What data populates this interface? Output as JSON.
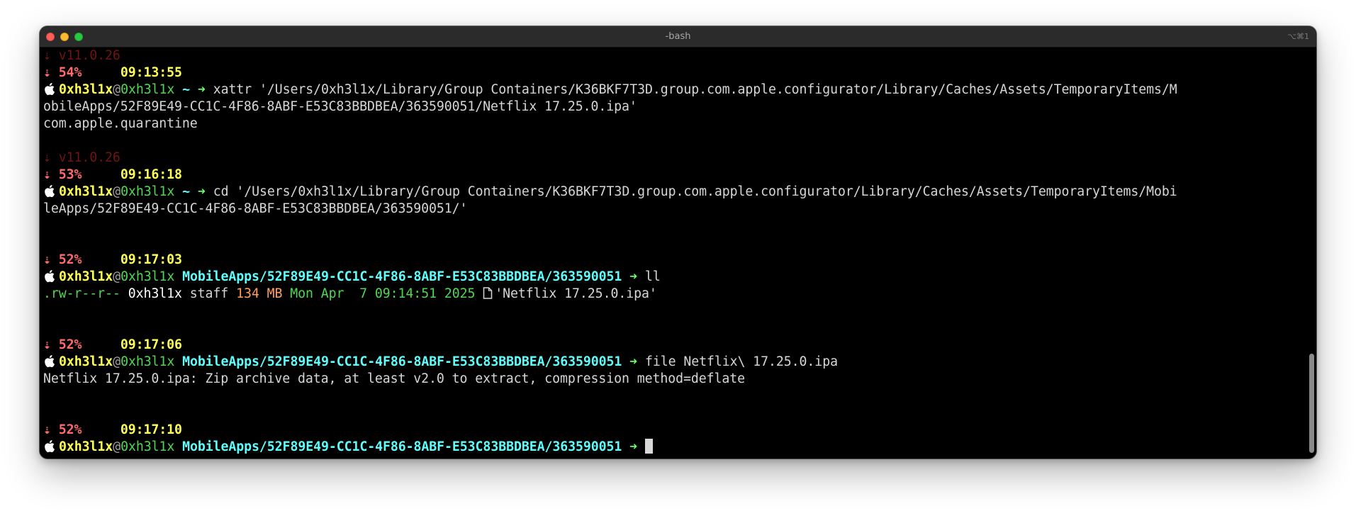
{
  "window": {
    "title": "-bash",
    "shortcut": "⌥⌘1"
  },
  "prompt": {
    "user": "0xh3l1x",
    "at": "@",
    "host": "0xh3l1x",
    "arrow": "➜",
    "home_dir": "~",
    "app_dir": "MobileApps/52F89E49-CC1C-4F86-8ABF-E53C83BBDBEA/363590051"
  },
  "blocks": [
    {
      "version": "⇣ v11.0.26",
      "battery": "⇣ 54%",
      "time": "09:13:55",
      "command_line_1": "xattr '/Users/0xh3l1x/Library/Group Containers/K36BKF7T3D.group.com.apple.configurator/Library/Caches/Assets/TemporaryItems/M",
      "command_line_2": "obileApps/52F89E49-CC1C-4F86-8ABF-E53C83BBDBEA/363590051/Netflix 17.25.0.ipa'",
      "output": "com.apple.quarantine"
    },
    {
      "version": "⇣ v11.0.26",
      "battery": "⇣ 53%",
      "time": "09:16:18",
      "command_line_1": "cd '/Users/0xh3l1x/Library/Group Containers/K36BKF7T3D.group.com.apple.configurator/Library/Caches/Assets/TemporaryItems/Mobi",
      "command_line_2": "leApps/52F89E49-CC1C-4F86-8ABF-E53C83BBDBEA/363590051/'"
    },
    {
      "battery": "⇣ 52%",
      "time": "09:17:03",
      "command": "ll",
      "listing": {
        "permissions": ".rw-r--r--",
        "owner": "0xh3l1x",
        "group": "staff",
        "size": "134 MB",
        "date": "Mon Apr  7 09:14:51 2025",
        "file_icon": "file-icon",
        "filename": "'Netflix 17.25.0.ipa'"
      }
    },
    {
      "battery": "⇣ 52%",
      "time": "09:17:06",
      "command": "file Netflix\\ 17.25.0.ipa",
      "output": "Netflix 17.25.0.ipa: Zip archive data, at least v2.0 to extract, compression method=deflate"
    },
    {
      "battery": "⇣ 52%",
      "time": "09:17:10"
    }
  ],
  "icons": {
    "prompt_logo": "apple-icon",
    "file": "file-icon",
    "cursor": "cursor-block"
  },
  "colors": {
    "background": "#000000",
    "titlebar": "#2b2b2b",
    "battery": "#ff6b6b",
    "clock": "#ffff55",
    "user": "#ffff55",
    "host": "#4fd84f",
    "directory": "#5ffcfc",
    "arrow": "#66ff66",
    "size": "#ff9f5a",
    "version": "#6e1414"
  }
}
